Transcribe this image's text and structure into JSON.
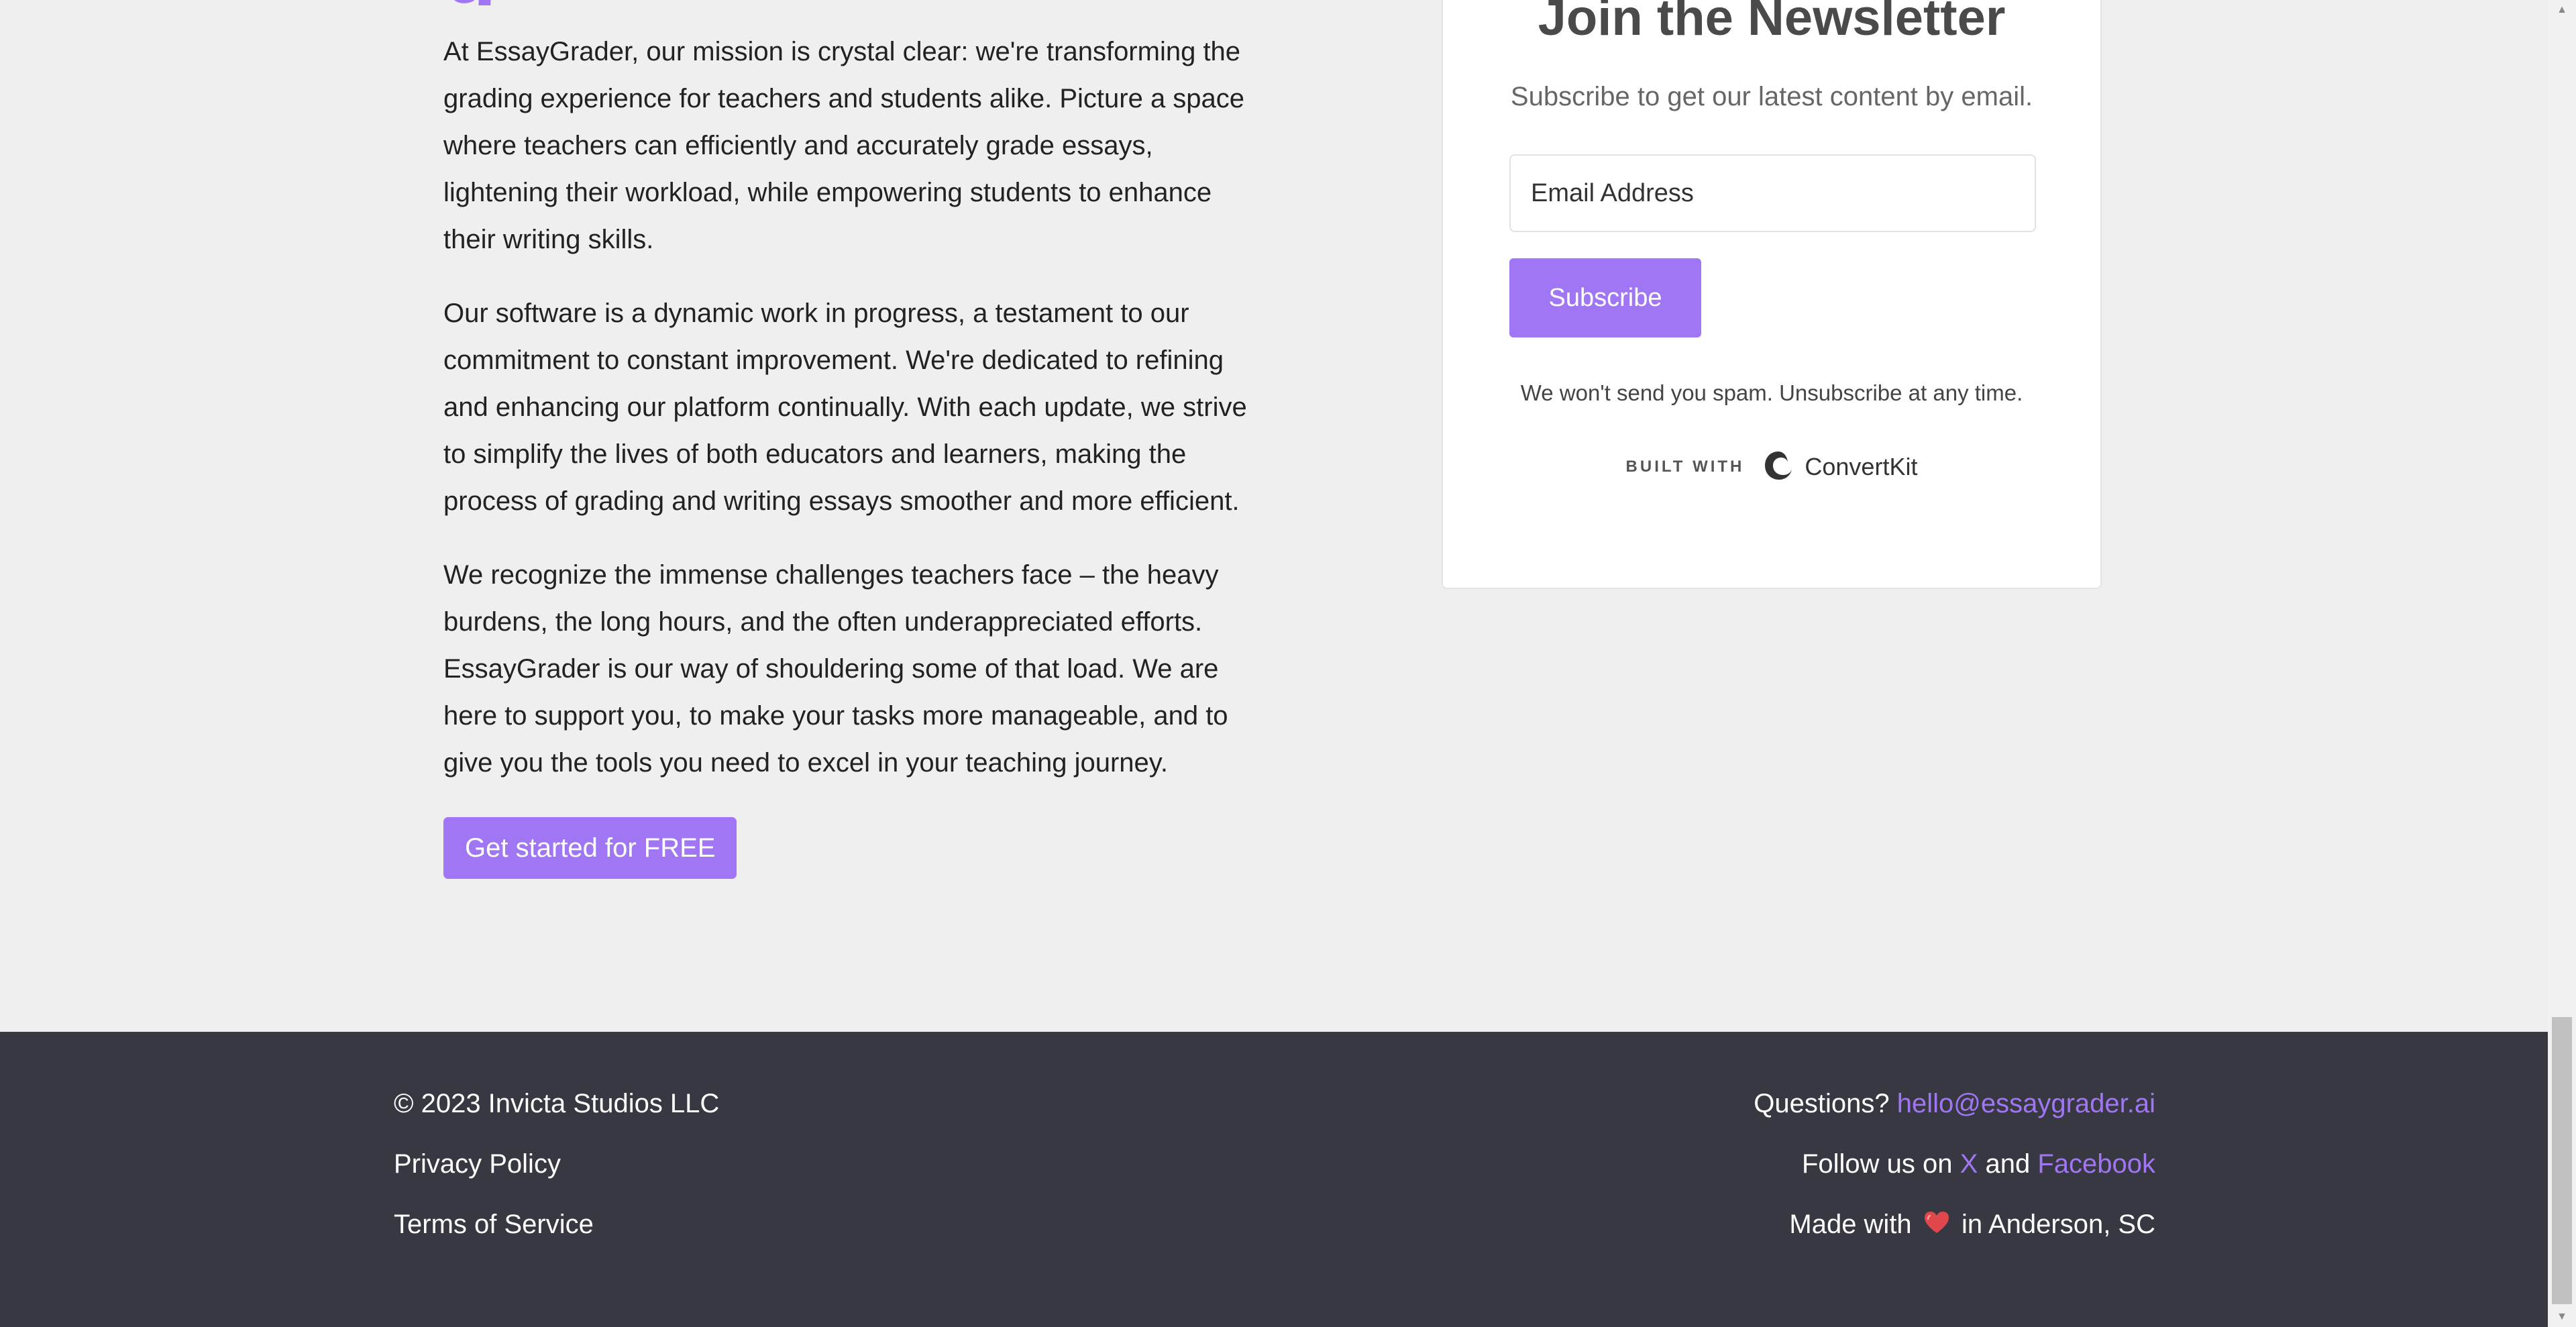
{
  "about": {
    "heading_fragment": "g",
    "paragraphs": [
      "At EssayGrader, our mission is crystal clear: we're transforming the grading experience for teachers and students alike. Picture a space where teachers can efficiently and accurately grade essays, lightening their workload, while empowering students to enhance their writing skills.",
      "Our software is a dynamic work in progress, a testament to our commitment to constant improvement. We're dedicated to refining and enhancing our platform continually. With each update, we strive to simplify the lives of both educators and learners, making the process of grading and writing essays smoother and more efficient.",
      "We recognize the immense challenges teachers face – the heavy burdens, the long hours, and the often underappreciated efforts. EssayGrader is our way of shouldering some of that load. We are here to support you, to make your tasks more manageable, and to give you the tools you need to excel in your teaching journey."
    ],
    "cta_label": "Get started for FREE"
  },
  "newsletter": {
    "title": "Join the Newsletter",
    "subtitle": "Subscribe to get our latest content by email.",
    "email_placeholder": "Email Address",
    "subscribe_label": "Subscribe",
    "disclaimer": "We won't send you spam. Unsubscribe at any time.",
    "built_with_label": "BUILT WITH",
    "built_with_brand": "ConvertKit"
  },
  "footer": {
    "copyright": "© 2023 Invicta Studios LLC",
    "privacy_label": "Privacy Policy",
    "terms_label": "Terms of Service",
    "questions_prefix": "Questions?",
    "email": "hello@essaygrader.ai",
    "follow_prefix": "Follow us on",
    "x_label": "X",
    "and_text": "and",
    "facebook_label": "Facebook",
    "made_with_prefix": "Made with",
    "made_in": "in Anderson, SC"
  },
  "colors": {
    "accent": "#a076f5",
    "footer_bg": "#373841",
    "page_bg": "#efefef"
  },
  "icons": {
    "heart": "heart-icon",
    "convertkit": "convertkit-logo-icon"
  }
}
